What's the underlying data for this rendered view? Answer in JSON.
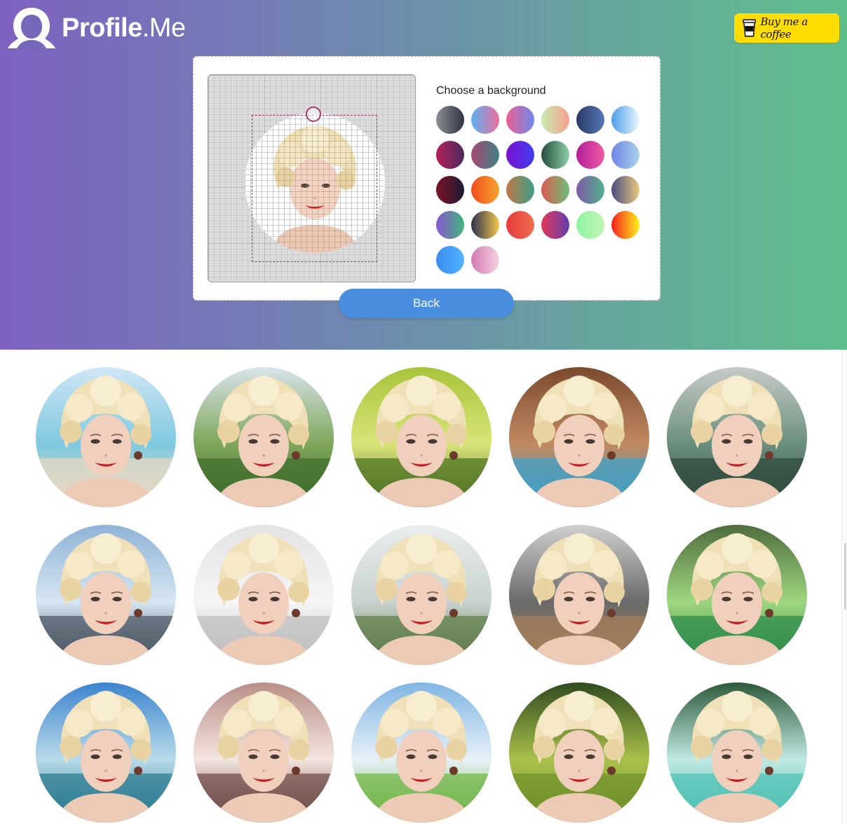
{
  "header": {
    "brand_bold": "Profile",
    "brand_light": ".Me",
    "coffee_label": "Buy me a coffee"
  },
  "editor": {
    "background_label": "Choose a background",
    "swatches": [
      {
        "from": "#8c8f96",
        "to": "#2d3340"
      },
      {
        "from": "#5ab3ee",
        "to": "#ee6d9e"
      },
      {
        "from": "#ec5f8f",
        "to": "#6f88ee"
      },
      {
        "from": "#c8ecb2",
        "to": "#f6a08e"
      },
      {
        "from": "#293a66",
        "to": "#5677b8"
      },
      {
        "from": "#4e9ee8",
        "to": "#e9f6ff"
      },
      {
        "from": "#b51f5d",
        "to": "#4a2a5a"
      },
      {
        "from": "#a64a72",
        "to": "#3d7f84"
      },
      {
        "from": "#7c12cf",
        "to": "#3f3df1"
      },
      {
        "from": "#264d3c",
        "to": "#8bd0a8"
      },
      {
        "from": "#b21f99",
        "to": "#ef5aa4"
      },
      {
        "from": "#6f83e7",
        "to": "#a8d2e8"
      },
      {
        "from": "#7a1226",
        "to": "#1d1a32"
      },
      {
        "from": "#f04b1d",
        "to": "#f7a52f"
      },
      {
        "from": "#bf7846",
        "to": "#3e9e87"
      },
      {
        "from": "#dc5a4e",
        "to": "#6bc07a"
      },
      {
        "from": "#825aa8",
        "to": "#4fb08c"
      },
      {
        "from": "#474c82",
        "to": "#e9c97b"
      },
      {
        "from": "#8a55d4",
        "to": "#41b67a"
      },
      {
        "from": "#2d3150",
        "to": "#f1c64c"
      },
      {
        "from": "#e53c3c",
        "to": "#f06d4f"
      },
      {
        "from": "#e23a56",
        "to": "#623db0"
      },
      {
        "from": "#8ef4a2",
        "to": "#c2f5b5"
      },
      {
        "from": "#f51f1f",
        "to": "#fff21a"
      },
      {
        "from": "#3b8df0",
        "to": "#53b3ff"
      },
      {
        "from": "#d47ab2",
        "to": "#f3d2e3"
      }
    ],
    "back_label": "Back"
  },
  "gallery": {
    "items": [
      {
        "name": "beach",
        "sky": "#cfe6f6",
        "ground": "#e8d8c2",
        "accent": "#7fc9e0"
      },
      {
        "name": "green-valley",
        "sky": "#d8e4ea",
        "ground": "#3f6e2c",
        "accent": "#7fa65a"
      },
      {
        "name": "jungle-light",
        "sky": "#a8c43a",
        "ground": "#4e7423",
        "accent": "#d9e479"
      },
      {
        "name": "sea-cave",
        "sky": "#7b4a2e",
        "ground": "#3ea0c8",
        "accent": "#c18a61"
      },
      {
        "name": "mountain-lake",
        "sky": "#c6cbc7",
        "ground": "#2f4a3c",
        "accent": "#6b8f7f"
      },
      {
        "name": "glass-office",
        "sky": "#8fb3d6",
        "ground": "#4a5562",
        "accent": "#d6e6f2"
      },
      {
        "name": "white-office",
        "sky": "#e3e3e3",
        "ground": "#bdbdbd",
        "accent": "#f6f6f6"
      },
      {
        "name": "bright-office",
        "sky": "#e9eeee",
        "ground": "#5d7a4a",
        "accent": "#c9d3cf"
      },
      {
        "name": "wood-office",
        "sky": "#d0d0cf",
        "ground": "#a47f5a",
        "accent": "#6a6a6a"
      },
      {
        "name": "forest-stream",
        "sky": "#4f6c3d",
        "ground": "#2d8c4a",
        "accent": "#9ed67f"
      },
      {
        "name": "harbor",
        "sky": "#3c84cf",
        "ground": "#2b7a92",
        "accent": "#b8dbe9"
      },
      {
        "name": "bokeh",
        "sky": "#b98f86",
        "ground": "#6d4a45",
        "accent": "#f4e5e0"
      },
      {
        "name": "meadow-sky",
        "sky": "#7fb5e4",
        "ground": "#6fb543",
        "accent": "#e7f1f8"
      },
      {
        "name": "tree-field",
        "sky": "#2f4a1f",
        "ground": "#71912b",
        "accent": "#a9c14a"
      },
      {
        "name": "river-rapids",
        "sky": "#2d5a3a",
        "ground": "#4fc0b4",
        "accent": "#bfe8e2"
      }
    ]
  }
}
